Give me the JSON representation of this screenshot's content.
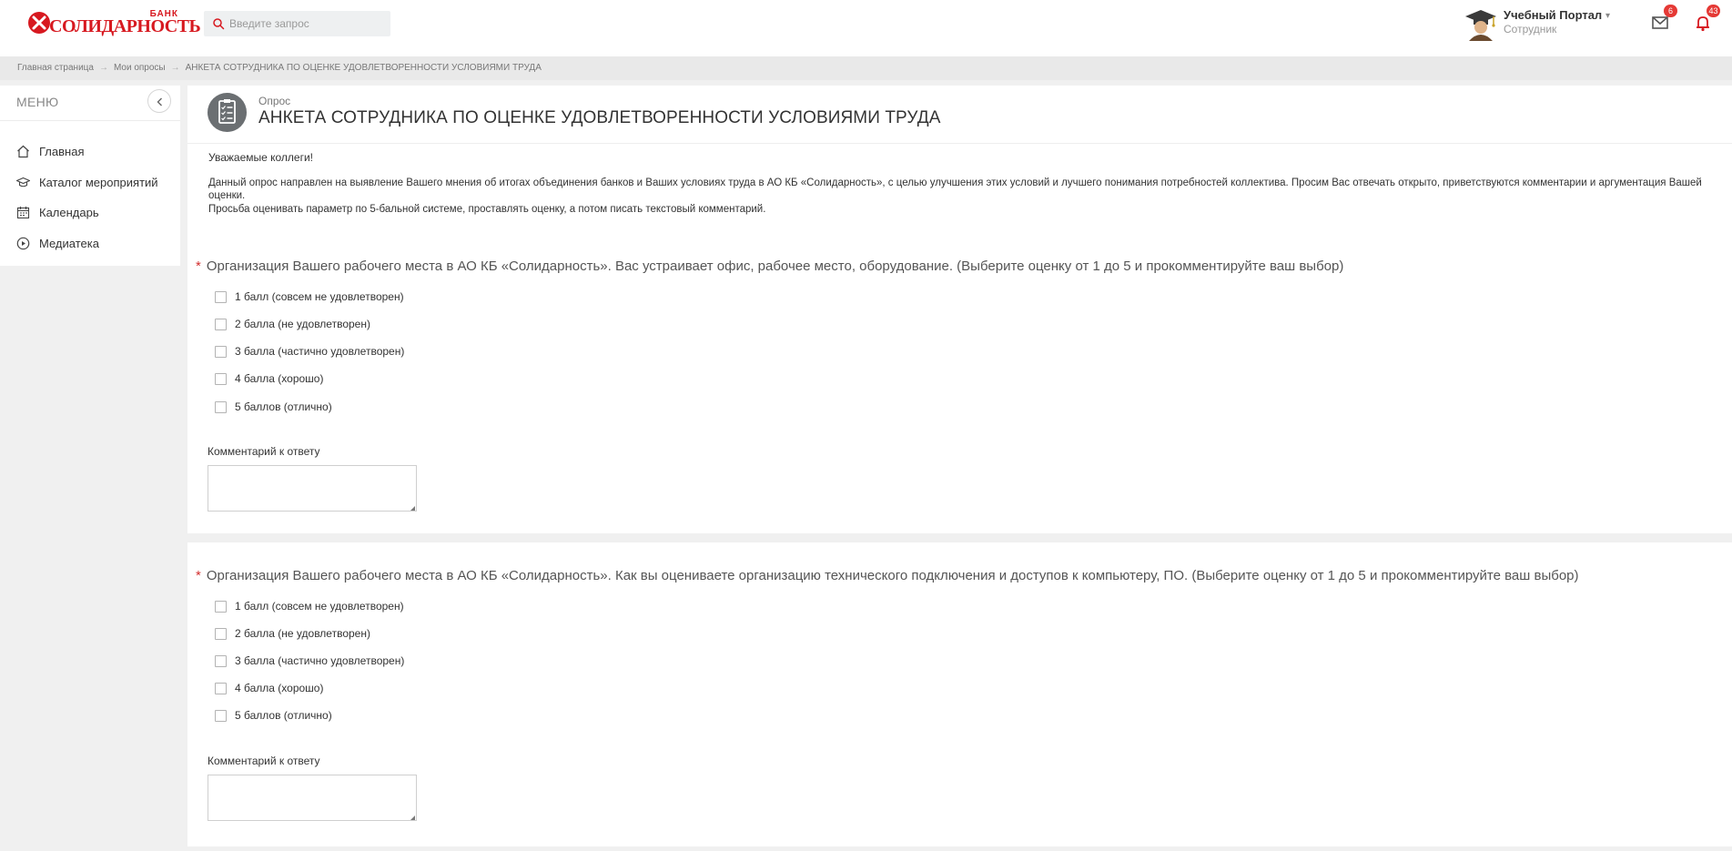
{
  "header": {
    "logo_text": "СОЛИДАРНОСТЬ",
    "logo_bank": "БАНК",
    "search_placeholder": "Введите запрос",
    "user_name": "Учебный Портал",
    "user_role": "Сотрудник",
    "messages_badge": "6",
    "notifications_badge": "43"
  },
  "breadcrumb": [
    "Главная страница",
    "Мои опросы",
    "АНКЕТА СОТРУДНИКА ПО ОЦЕНКЕ УДОВЛЕТВОРЕННОСТИ УСЛОВИЯМИ ТРУДА"
  ],
  "sidebar": {
    "title": "МЕНЮ",
    "items": [
      {
        "label": "Главная",
        "icon": "home-icon"
      },
      {
        "label": "Каталог мероприятий",
        "icon": "graduation-cap-icon"
      },
      {
        "label": "Календарь",
        "icon": "calendar-icon"
      },
      {
        "label": "Медиатека",
        "icon": "play-circle-icon"
      }
    ]
  },
  "survey": {
    "type": "Опрос",
    "title": "АНКЕТА СОТРУДНИКА ПО ОЦЕНКЕ УДОВЛЕТВОРЕННОСТИ УСЛОВИЯМИ ТРУДА",
    "greeting": "Уважаемые коллеги!",
    "intro_1": "Данный  опрос направлен на выявление Вашего мнения об итогах объединения банков и Ваших условиях труда в АО КБ «Солидарность», с целью улучшения этих условий  и лучшего понимания потребностей коллектива. Просим Вас отвечать открыто, приветствуются комментарии и аргументация Вашей оценки.",
    "intro_2": "Просьба оценивать параметр по 5-бальной системе, проставлять оценку, а потом писать текстовый комментарий."
  },
  "questions": [
    {
      "text": "Организация Вашего рабочего места в АО КБ «Солидарность». Вас устраивает офис, рабочее место, оборудование. (Выберите оценку от 1 до 5 и прокомментируйте ваш выбор)",
      "options": [
        "1 балл (совсем не удовлетворен)",
        "2 балла (не удовлетворен)",
        "3 балла (частично удовлетворен)",
        "4 балла (хорошо)",
        "5 баллов (отлично)"
      ],
      "comment_label": "Комментарий к ответу"
    },
    {
      "text": "Организация Вашего рабочего места в АО КБ «Солидарность». Как вы оцениваете организацию технического подключения и доступов к компьютеру, ПО. (Выберите оценку от 1 до 5 и прокомментируйте ваш выбор)",
      "options": [
        "1 балл (совсем не удовлетворен)",
        "2 балла (не удовлетворен)",
        "3 балла (частично удовлетворен)",
        "4 балла (хорошо)",
        "5 баллов (отлично)"
      ],
      "comment_label": "Комментарий к ответу"
    }
  ],
  "colors": {
    "brand": "#d71920",
    "badge": "#e53935",
    "required": "#d32f2f"
  }
}
